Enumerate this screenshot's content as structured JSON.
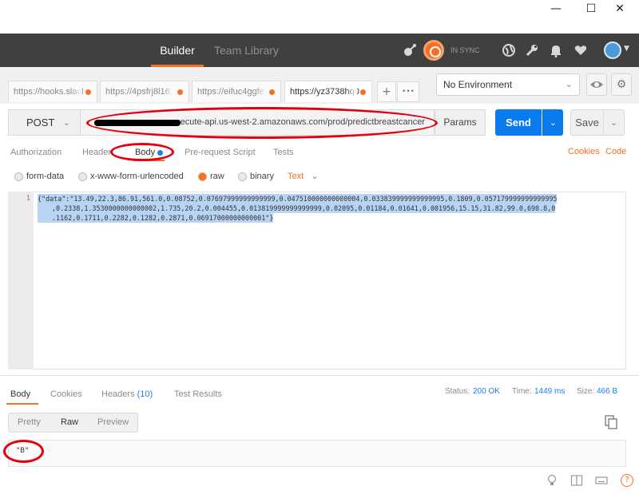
{
  "window": {
    "minimize_glyph": "—",
    "maximize_glyph": "☐",
    "close_glyph": "✕"
  },
  "header": {
    "tabs": [
      "Builder",
      "Team Library"
    ],
    "sync_status": "IN SYNC",
    "accent_color": "#f47023",
    "icons": [
      "satellite-icon",
      "sync-icon",
      "globe-icon",
      "wrench-icon",
      "bell-icon",
      "heart-icon",
      "avatar"
    ]
  },
  "request_tabs": [
    {
      "label": "https://hooks.slacl"
    },
    {
      "label": "https://4psfrj8l16."
    },
    {
      "label": "https://eifuc4ggfe."
    },
    {
      "label": "https://yz3738hq0"
    }
  ],
  "tab_controls": {
    "add": "+",
    "more": "•••"
  },
  "environment": {
    "selected": "No Environment"
  },
  "request": {
    "method": "POST",
    "url": ".execute-api.us-west-2.amazonaws.com/prod/predictbreastcancer",
    "params_label": "Params",
    "send_label": "Send",
    "save_label": "Save"
  },
  "request_subtabs": [
    "Authorization",
    "Headers",
    "Body",
    "Pre-request Script",
    "Tests"
  ],
  "request_links": {
    "cookies": "Cookies",
    "code": "Code"
  },
  "body_types": {
    "options": [
      "form-data",
      "x-www-form-urlencoded",
      "raw",
      "binary"
    ],
    "selected": "raw",
    "content_type": "Text"
  },
  "editor": {
    "line_number": "1",
    "lines": [
      "{\"data\":\"13.49,22.3,86.91,561.0,0.08752,0.07697999999999999,0.047510000000000004,0.033839999999999995,0.1809,0.057179999999999995",
      ",0.2338,1.3530000000000002,1.735,20.2,0.004455,0.013819999999999999,0.02095,0.01184,0.01641,0.001956,15.15,31.82,99.0,698.8,0",
      ".1162,0.1711,0.2282,0.1282,0.2871,0.06917000000000001\"}"
    ]
  },
  "response_tabs": {
    "body": "Body",
    "cookies": "Cookies",
    "headers": "Headers",
    "headers_count": "(10)",
    "test_results": "Test Results"
  },
  "response_meta": {
    "status_label": "Status:",
    "status_value": "200 OK",
    "time_label": "Time:",
    "time_value": "1449 ms",
    "size_label": "Size:",
    "size_value": "466 B"
  },
  "response_format": {
    "options": [
      "Pretty",
      "Raw",
      "Preview"
    ],
    "selected": "Raw"
  },
  "response_body": "\"B\""
}
